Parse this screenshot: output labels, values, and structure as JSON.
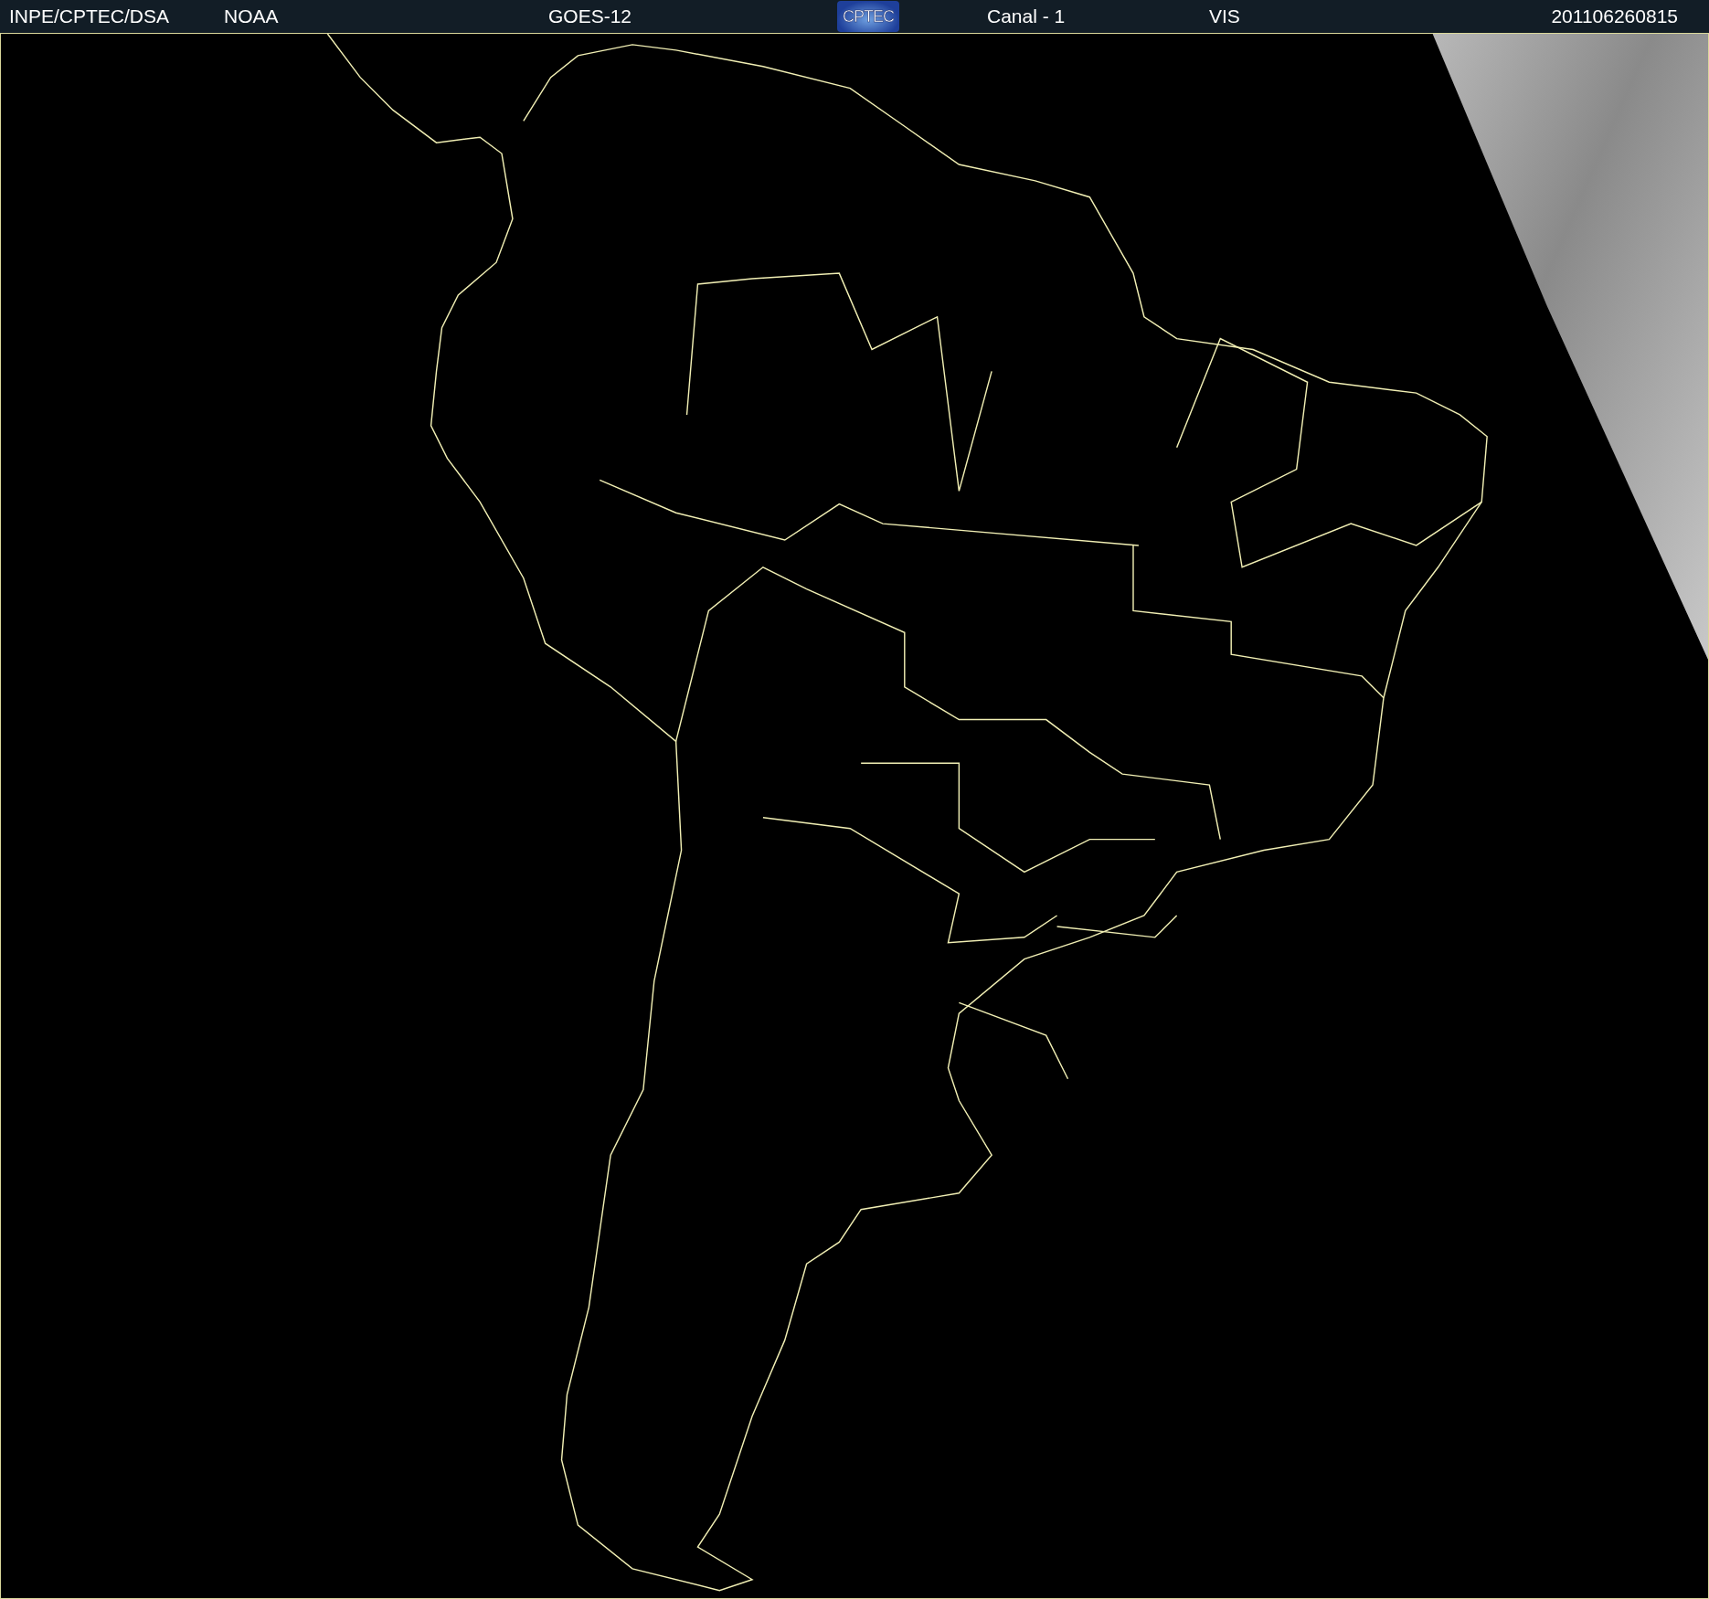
{
  "header": {
    "agency": "INPE/CPTEC/DSA",
    "source": "NOAA",
    "satellite": "GOES-12",
    "logo": "CPTEC",
    "channel": "Canal - 1",
    "band": "VIS",
    "timestamp": "201106260815"
  }
}
